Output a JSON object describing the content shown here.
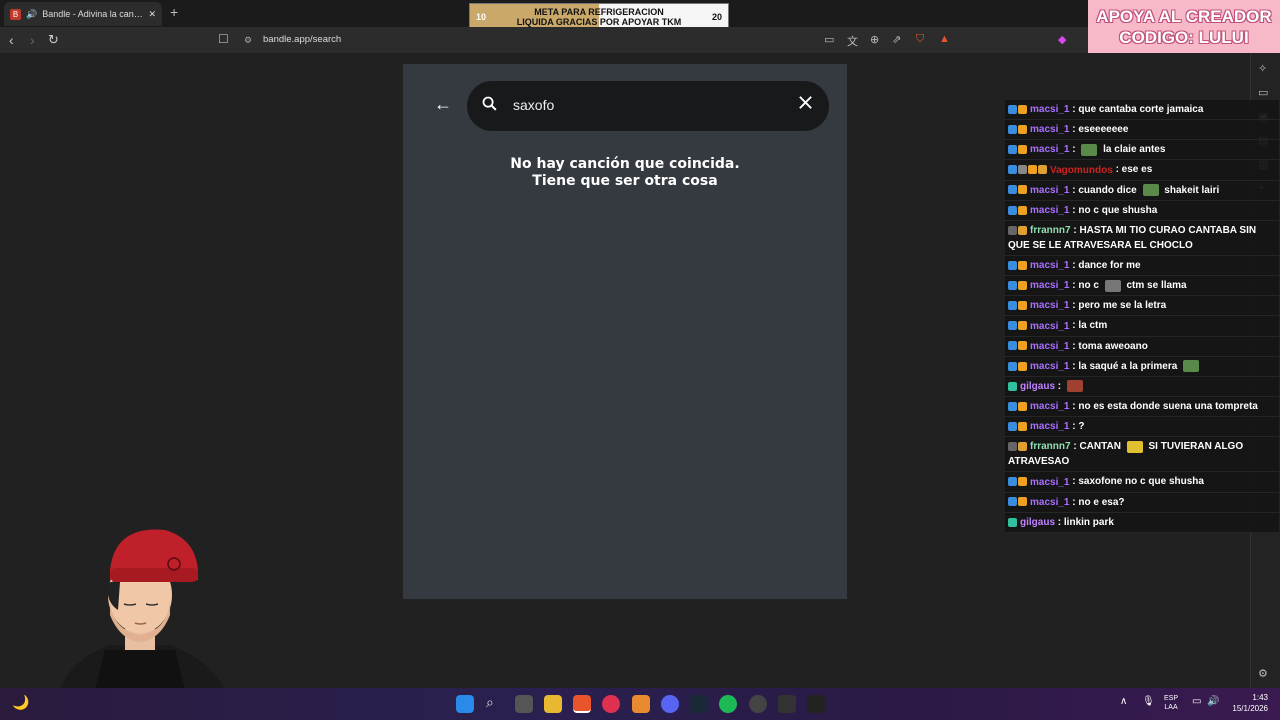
{
  "browser": {
    "tab_title": "Bandle - Adivina la canción, u",
    "tab_favicon": "B",
    "new_tab": "+",
    "close_tab": "✕",
    "url": "bandle.app/search"
  },
  "goal_widget": {
    "title_line1": "META PARA REFRIGERACION",
    "title_line2": "LIQUIDA GRACIAS POR APOYAR TKM",
    "min": "10",
    "max": "20",
    "progress_fraction": 0.5
  },
  "promo": {
    "line1": "APOYA AL CREADOR",
    "line2": "CODIGO: LULUI"
  },
  "app": {
    "search_value": "saxofo",
    "no_match_line1": "No hay canción que coincida.",
    "no_match_line2": "Tiene que ser otra cosa"
  },
  "chat": [
    {
      "user": "macsi_1",
      "color": "#a970ff",
      "text": ": que cantaba corte jamaica",
      "badges": [
        "#3a8dde",
        "#f0a020"
      ]
    },
    {
      "user": "macsi_1",
      "color": "#a970ff",
      "text": ": eseeeeeee",
      "badges": [
        "#3a8dde",
        "#f0a020"
      ]
    },
    {
      "user": "macsi_1",
      "color": "#a970ff",
      "text": ": ",
      "text2": " la claie antes",
      "emote": "#5a8a4a",
      "badges": [
        "#3a8dde",
        "#f0a020"
      ]
    },
    {
      "user": "Vagomundos",
      "color": "#d02020",
      "text": ": ese es",
      "badges": [
        "#3a8dde",
        "#888888",
        "#f0a020",
        "#e0a030"
      ]
    },
    {
      "user": "macsi_1",
      "color": "#a970ff",
      "text": ": cuando dice ",
      "text2": " shakeit lairi",
      "emote": "#5a8a4a",
      "badges": [
        "#3a8dde",
        "#f0a020"
      ]
    },
    {
      "user": "macsi_1",
      "color": "#a970ff",
      "text": ": no c que shusha",
      "badges": [
        "#3a8dde",
        "#f0a020"
      ]
    },
    {
      "user": "frrannn7",
      "color": "#8fe0b0",
      "text": ": HASTA MI TIO CURAO CANTABA SIN QUE SE LE ATRAVESARA EL CHOCLO",
      "badges": [
        "#666666",
        "#e0a030"
      ]
    },
    {
      "user": "macsi_1",
      "color": "#a970ff",
      "text": ": dance for me",
      "badges": [
        "#3a8dde",
        "#f0a020"
      ]
    },
    {
      "user": "macsi_1",
      "color": "#a970ff",
      "text": ": no c ",
      "text2": " ctm se llama",
      "emote": "#777777",
      "badges": [
        "#3a8dde",
        "#f0a020"
      ]
    },
    {
      "user": "macsi_1",
      "color": "#a970ff",
      "text": ": pero me se la letra",
      "badges": [
        "#3a8dde",
        "#f0a020"
      ]
    },
    {
      "user": "macsi_1",
      "color": "#a970ff",
      "text": ": la ctm",
      "badges": [
        "#3a8dde",
        "#f0a020"
      ]
    },
    {
      "user": "macsi_1",
      "color": "#a970ff",
      "text": ": toma aweoano",
      "badges": [
        "#3a8dde",
        "#f0a020"
      ]
    },
    {
      "user": "macsi_1",
      "color": "#a970ff",
      "text": ": la saqué a la primera ",
      "emote": "#5a8a4a",
      "badges": [
        "#3a8dde",
        "#f0a020"
      ]
    },
    {
      "user": "gilgaus",
      "color": "#c080ff",
      "text": ": ",
      "emote": "#a04030",
      "badges": [
        "#30c0a0"
      ]
    },
    {
      "user": "macsi_1",
      "color": "#a970ff",
      "text": ": no es esta donde suena una tompreta",
      "badges": [
        "#3a8dde",
        "#f0a020"
      ]
    },
    {
      "user": "macsi_1",
      "color": "#a970ff",
      "text": ": ?",
      "badges": [
        "#3a8dde",
        "#f0a020"
      ]
    },
    {
      "user": "frrannn7",
      "color": "#8fe0b0",
      "text": ": CANTAN ",
      "text2": " SI TUVIERAN ALGO ATRAVESAO",
      "emote": "#e0c030",
      "badges": [
        "#666666",
        "#e0a030"
      ]
    },
    {
      "user": "macsi_1",
      "color": "#a970ff",
      "text": ": saxofone no c que shusha",
      "badges": [
        "#3a8dde",
        "#f0a020"
      ]
    },
    {
      "user": "macsi_1",
      "color": "#a970ff",
      "text": ": no e esa?",
      "badges": [
        "#3a8dde",
        "#f0a020"
      ]
    },
    {
      "user": "gilgaus",
      "color": "#c080ff",
      "text": ": linkin park",
      "badges": [
        "#30c0a0"
      ]
    }
  ],
  "taskbar": {
    "lang_line1": "ESP",
    "lang_line2": "LAA",
    "time": "1:43",
    "date": "15/1/2026"
  }
}
